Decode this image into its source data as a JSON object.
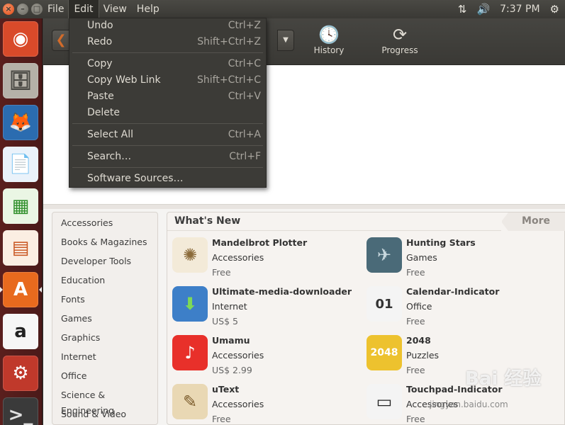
{
  "window_controls": {
    "close": "×",
    "minimize": "–",
    "maximize": "□"
  },
  "menubar": {
    "items": [
      "File",
      "Edit",
      "View",
      "Help"
    ]
  },
  "indicators": {
    "network_icon": "⇅",
    "volume_icon": "🔊",
    "time": "7:37 PM",
    "settings_icon": "⚙"
  },
  "launcher": {
    "items": [
      {
        "name": "ubuntu-dash",
        "glyph": "◉",
        "bg": "#d94a2a",
        "fg": "#ffffff"
      },
      {
        "name": "files",
        "glyph": "🗄",
        "bg": "#b5b1a8",
        "fg": "#4a4944"
      },
      {
        "name": "firefox",
        "glyph": "🦊",
        "bg": "#2b6cb0",
        "fg": "#f28a1d"
      },
      {
        "name": "libreoffice-writer",
        "glyph": "📄",
        "bg": "#eaf2fa",
        "fg": "#1f5ca8"
      },
      {
        "name": "libreoffice-calc",
        "glyph": "▦",
        "bg": "#eaf6e4",
        "fg": "#2f8f2a"
      },
      {
        "name": "libreoffice-impress",
        "glyph": "▤",
        "bg": "#fbeee2",
        "fg": "#c8531d"
      },
      {
        "name": "software-center",
        "glyph": "A",
        "bg": "#e86a1e",
        "fg": "#ffffff"
      },
      {
        "name": "amazon",
        "glyph": "a",
        "bg": "#f6f6f6",
        "fg": "#222222"
      },
      {
        "name": "system-settings",
        "glyph": "⚙",
        "bg": "#c0392b",
        "fg": "#ffffff"
      },
      {
        "name": "terminal",
        "glyph": ">_",
        "bg": "#3a3a3a",
        "fg": "#e0e0e0"
      }
    ]
  },
  "toolbar": {
    "back_icon": "❮",
    "dropdown_icon": "▼",
    "history_icon": "🕓",
    "history_label": "History",
    "progress_icon": "⟳",
    "progress_label": "Progress"
  },
  "edit_menu": [
    {
      "label": "Undo",
      "accel": "Ctrl+Z"
    },
    {
      "label": "Redo",
      "accel": "Shift+Ctrl+Z"
    },
    {
      "label": "Copy",
      "accel": "Ctrl+C"
    },
    {
      "label": "Copy Web Link",
      "accel": "Shift+Ctrl+C"
    },
    {
      "label": "Paste",
      "accel": "Ctrl+V"
    },
    {
      "label": "Delete",
      "accel": ""
    },
    {
      "label": "Select All",
      "accel": "Ctrl+A"
    },
    {
      "label": "Search…",
      "accel": "Ctrl+F"
    },
    {
      "label": "Software Sources…",
      "accel": ""
    }
  ],
  "categories": [
    "Accessories",
    "Books & Magazines",
    "Developer Tools",
    "Education",
    "Fonts",
    "Games",
    "Graphics",
    "Internet",
    "Office",
    "Science & Engineering",
    "Sound & Video"
  ],
  "whats_new": {
    "title": "What's New",
    "more_label": "More",
    "apps": [
      {
        "name": "Mandelbrot Plotter",
        "category": "Accessories",
        "price": "Free",
        "icon": "✺",
        "icon_bg": "#f3ead8",
        "icon_fg": "#8b6b3a"
      },
      {
        "name": "Hunting Stars",
        "category": "Games",
        "price": "Free",
        "icon": "✈",
        "icon_bg": "#4a6a78",
        "icon_fg": "#c8d8de"
      },
      {
        "name": "Ultimate-media-downloader",
        "category": "Internet",
        "price": "US$ 5",
        "icon": "⬇",
        "icon_bg": "#3d7fc8",
        "icon_fg": "#7ed957"
      },
      {
        "name": "Calendar-Indicator",
        "category": "Office",
        "price": "Free",
        "icon": "01",
        "icon_bg": "#f4f4f4",
        "icon_fg": "#333333"
      },
      {
        "name": "Umamu",
        "category": "Accessories",
        "price": "US$ 2.99",
        "icon": "♪",
        "icon_bg": "#e8302a",
        "icon_fg": "#ffffff"
      },
      {
        "name": "2048",
        "category": "Puzzles",
        "price": "Free",
        "icon": "2048",
        "icon_bg": "#edc22e",
        "icon_fg": "#ffffff"
      },
      {
        "name": "uText",
        "category": "Accessories",
        "price": "Free",
        "icon": "✎",
        "icon_bg": "#e9d8b4",
        "icon_fg": "#7a5a2a"
      },
      {
        "name": "Touchpad-Indicator",
        "category": "Accessories",
        "price": "Free",
        "icon": "▭",
        "icon_bg": "#f4f4f4",
        "icon_fg": "#222222"
      }
    ]
  },
  "watermark": {
    "logo": "Bai 经验",
    "url": "jingyan.baidu.com"
  }
}
